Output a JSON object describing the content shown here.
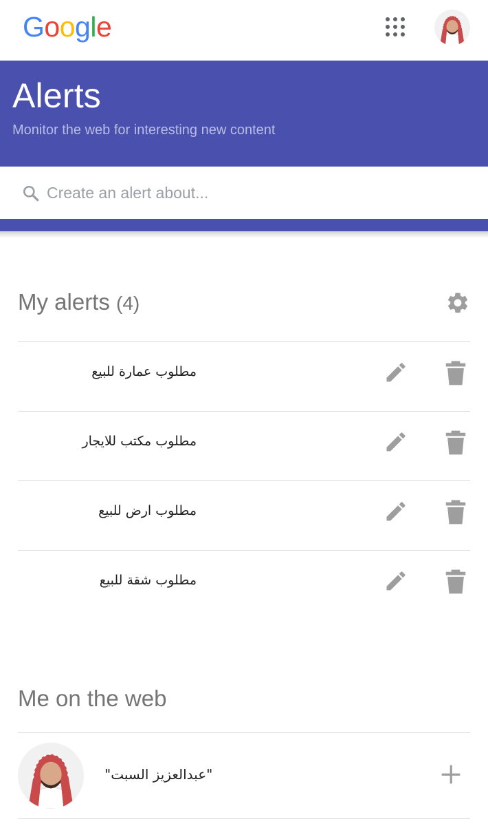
{
  "logo": {
    "text": "Google",
    "letters": [
      {
        "ch": "G",
        "color": "#4285F4"
      },
      {
        "ch": "o",
        "color": "#EA4335"
      },
      {
        "ch": "o",
        "color": "#FBBC05"
      },
      {
        "ch": "g",
        "color": "#4285F4"
      },
      {
        "ch": "l",
        "color": "#34A853"
      },
      {
        "ch": "e",
        "color": "#EA4335"
      }
    ]
  },
  "topbar": {
    "apps_icon": "apps-grid-icon",
    "avatar_icon": "user-avatar"
  },
  "header": {
    "title": "Alerts",
    "subtitle": "Monitor the web for interesting new content",
    "background": "#4a50ae"
  },
  "search": {
    "placeholder": "Create an alert about...",
    "icon": "search-icon"
  },
  "my_alerts": {
    "title": "My alerts",
    "count": "(4)",
    "settings_icon": "gear-icon",
    "items": [
      {
        "label": "مطلوب عمارة للبيع"
      },
      {
        "label": "مطلوب مكتب للايجار"
      },
      {
        "label": "مطلوب ارض للبيع"
      },
      {
        "label": "مطلوب شقة للبيع"
      }
    ],
    "edit_icon": "pencil-icon",
    "delete_icon": "trash-icon"
  },
  "me_on_web": {
    "title": "Me on the web",
    "name": "\"عبدالعزيز السبت\"",
    "add_icon": "plus-icon"
  }
}
